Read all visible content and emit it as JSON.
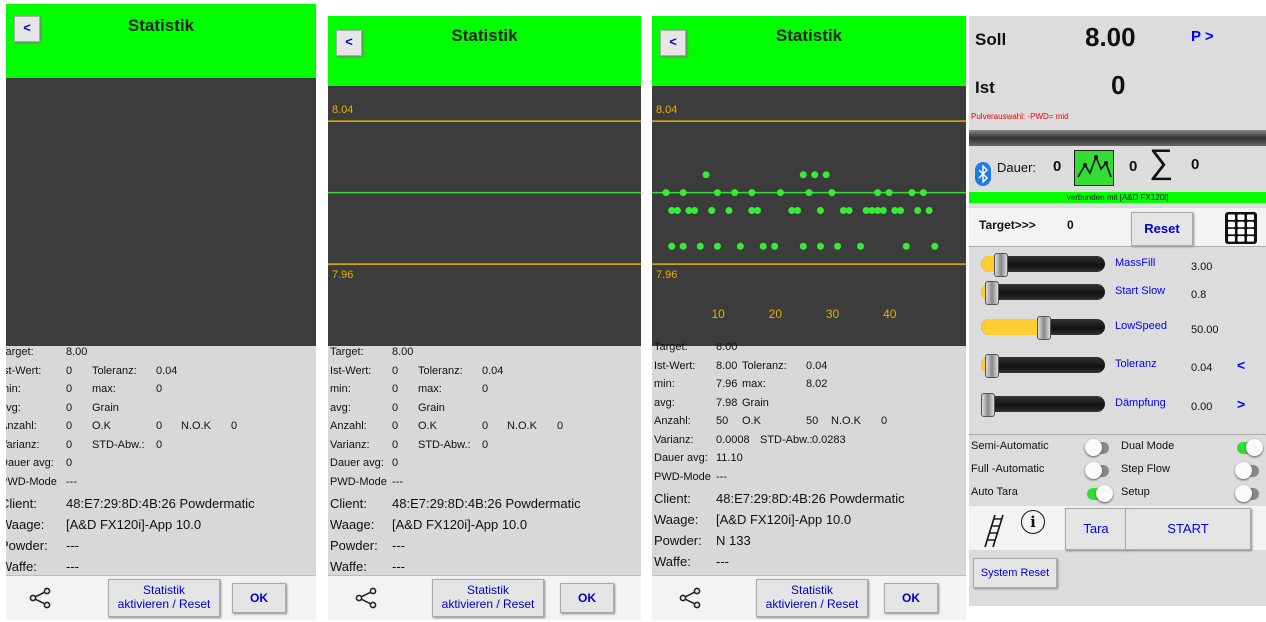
{
  "panels": [
    {
      "header": {
        "back_label": "<",
        "title": "Statistik"
      },
      "plot": {
        "upper_label": "",
        "lower_label": "",
        "x_ticks": []
      },
      "stats": {
        "target_label": "Target:",
        "target_value": "8.00",
        "ist_label": "Ist-Wert:",
        "ist_value": "0",
        "toleranz_label": "Toleranz:",
        "toleranz_value": "0.04",
        "min_label": "min:",
        "min_value": "0",
        "max_label": "max:",
        "max_value": "0",
        "avg_label": "avg:",
        "avg_value": "0",
        "unit": "Grain",
        "anzahl_label": "Anzahl:",
        "anzahl_value": "0",
        "ok_label": "O.K",
        "ok_value": "0",
        "nok_label": "N.O.K",
        "nok_value": "0",
        "varianz_label": "Varianz:",
        "varianz_value": "0",
        "std_label": "STD-Abw.:",
        "std_value": "0",
        "dauer_label": "Dauer avg:",
        "dauer_value": "0",
        "pwd_label": "PWD-Mode",
        "pwd_value": "---",
        "client_label": "Client:",
        "client_value": "48:E7:29:8D:4B:26 Powdermatic",
        "waage_label": "Waage:",
        "waage_value": "[A&D FX120i]-App 10.0",
        "powder_label": "Powder:",
        "powder_value": "---",
        "waffe_label": "Waffe:",
        "waffe_value": "---"
      },
      "buttons": {
        "stat_line1": "Statistik",
        "stat_line2": "aktivieren / Reset",
        "ok": "OK"
      }
    },
    {
      "header": {
        "back_label": "<",
        "title": "Statistik"
      },
      "plot": {
        "upper_label": "8.04",
        "lower_label": "7.96",
        "x_ticks": []
      },
      "stats": {
        "target_label": "Target:",
        "target_value": "8.00",
        "ist_label": "Ist-Wert:",
        "ist_value": "0",
        "toleranz_label": "Toleranz:",
        "toleranz_value": "0.04",
        "min_label": "min:",
        "min_value": "0",
        "max_label": "max:",
        "max_value": "0",
        "avg_label": "avg:",
        "avg_value": "0",
        "unit": "Grain",
        "anzahl_label": "Anzahl:",
        "anzahl_value": "0",
        "ok_label": "O.K",
        "ok_value": "0",
        "nok_label": "N.O.K",
        "nok_value": "0",
        "varianz_label": "Varianz:",
        "varianz_value": "0",
        "std_label": "STD-Abw.:",
        "std_value": "0",
        "dauer_label": "Dauer avg:",
        "dauer_value": "0",
        "pwd_label": "PWD-Mode",
        "pwd_value": "---",
        "client_label": "Client:",
        "client_value": "48:E7:29:8D:4B:26 Powdermatic",
        "waage_label": "Waage:",
        "waage_value": "[A&D FX120i]-App 10.0",
        "powder_label": "Powder:",
        "powder_value": "---",
        "waffe_label": "Waffe:",
        "waffe_value": "---"
      },
      "buttons": {
        "stat_line1": "Statistik",
        "stat_line2": "aktivieren / Reset",
        "ok": "OK"
      }
    },
    {
      "header": {
        "back_label": "<",
        "title": "Statistik"
      },
      "plot": {
        "upper_label": "8.04",
        "lower_label": "7.96",
        "x_ticks": [
          "10",
          "20",
          "30",
          "40"
        ]
      },
      "stats": {
        "target_label": "Target:",
        "target_value": "8.00",
        "ist_label": "Ist-Wert:",
        "ist_value": "8.00",
        "toleranz_label": "Toleranz:",
        "toleranz_value": "0.04",
        "min_label": "min:",
        "min_value": "7.96",
        "max_label": "max:",
        "max_value": "8.02",
        "avg_label": "avg:",
        "avg_value": "7.98",
        "unit": "Grain",
        "anzahl_label": "Anzahl:",
        "anzahl_value": "50",
        "ok_label": "O.K",
        "ok_value": "50",
        "nok_label": "N.O.K",
        "nok_value": "0",
        "varianz_label": "Varianz:",
        "varianz_value": "0.0008",
        "std_label": "STD-Abw.:",
        "std_value": "0.0283",
        "dauer_label": "Dauer avg:",
        "dauer_value": "11.10",
        "pwd_label": "PWD-Mode",
        "pwd_value": "---",
        "client_label": "Client:",
        "client_value": "48:E7:29:8D:4B:26 Powdermatic",
        "waage_label": "Waage:",
        "waage_value": "[A&D FX120i]-App 10.0",
        "powder_label": "Powder:",
        "powder_value": "N 133",
        "waffe_label": "Waffe:",
        "waffe_value": "---"
      },
      "buttons": {
        "stat_line1": "Statistik",
        "stat_line2": "aktivieren / Reset",
        "ok": "OK"
      }
    }
  ],
  "chart_data": {
    "type": "scatter",
    "xlabel": "",
    "ylabel": "",
    "x_ticks": [
      10,
      20,
      30,
      40
    ],
    "xlim": [
      1,
      51
    ],
    "ylim": [
      7.95,
      8.06
    ],
    "reference_lines": {
      "upper": 8.04,
      "target": 8.0,
      "lower": 7.96
    },
    "points": [
      [
        1,
        8.0
      ],
      [
        2,
        7.99
      ],
      [
        2,
        7.97
      ],
      [
        3,
        7.99
      ],
      [
        4,
        8.0
      ],
      [
        4,
        7.97
      ],
      [
        5,
        7.99
      ],
      [
        6,
        7.99
      ],
      [
        7,
        7.97
      ],
      [
        8,
        8.01
      ],
      [
        9,
        7.99
      ],
      [
        10,
        8.0
      ],
      [
        10,
        7.97
      ],
      [
        12,
        7.99
      ],
      [
        13,
        8.0
      ],
      [
        14,
        7.97
      ],
      [
        16,
        7.99
      ],
      [
        16,
        8.0
      ],
      [
        17,
        7.99
      ],
      [
        18,
        7.97
      ],
      [
        20,
        7.97
      ],
      [
        21,
        8.0
      ],
      [
        23,
        7.99
      ],
      [
        24,
        7.99
      ],
      [
        25,
        8.01
      ],
      [
        25,
        7.97
      ],
      [
        26,
        8.0
      ],
      [
        27,
        8.01
      ],
      [
        28,
        7.99
      ],
      [
        28,
        7.97
      ],
      [
        29,
        8.01
      ],
      [
        30,
        8.0
      ],
      [
        31,
        7.97
      ],
      [
        32,
        7.99
      ],
      [
        33,
        7.99
      ],
      [
        35,
        7.97
      ],
      [
        36,
        7.99
      ],
      [
        37,
        7.99
      ],
      [
        38,
        8.0
      ],
      [
        38,
        7.99
      ],
      [
        39,
        7.99
      ],
      [
        40,
        8.0
      ],
      [
        41,
        7.99
      ],
      [
        42,
        7.99
      ],
      [
        43,
        7.97
      ],
      [
        44,
        8.0
      ],
      [
        45,
        7.99
      ],
      [
        46,
        8.0
      ],
      [
        47,
        7.99
      ],
      [
        48,
        7.97
      ]
    ]
  },
  "main_screen": {
    "soll_label": "Soll",
    "soll_value": "8.00",
    "p_button": "P >",
    "ist_label": "Ist",
    "ist_value": "0",
    "powder_select": "Pulverauswahl: -PWD= mid",
    "dauer_label": "Dauer:",
    "dauer_value": "0",
    "count_value": "0",
    "sum_symbol": "∑",
    "sum_value": "0",
    "status": "verbunden mit [A&D FX120i]",
    "target_label": "Target>>>",
    "target_value": "0",
    "reset_button": "Reset",
    "sliders": [
      {
        "label": "MassFill",
        "value": "3.00",
        "level": 0.15
      },
      {
        "label": "Start Slow",
        "value": "0.8",
        "level": 0.08
      },
      {
        "label": "LowSpeed",
        "value": "50.00",
        "level": 0.5
      },
      {
        "label": "Toleranz",
        "value": "0.04",
        "level": 0.08,
        "arrow": "<"
      },
      {
        "label": "Dämpfung",
        "value": "0.00",
        "level": 0.0,
        "arrow": ">"
      }
    ],
    "switches": [
      {
        "label": "Semi-Automatic",
        "on": false
      },
      {
        "label": "Dual Mode",
        "on": true
      },
      {
        "label": "Full -Automatic",
        "on": false
      },
      {
        "label": "Step Flow",
        "on": false
      },
      {
        "label": "Auto Tara",
        "on": true
      },
      {
        "label": "Setup",
        "on": false
      }
    ],
    "tara_button": "Tara",
    "start_button": "START",
    "system_reset_button": "System Reset",
    "colors": {
      "accent_green": "#00ff00",
      "link_blue": "#0000ff",
      "slider_yellow": "#ffcc33",
      "error_red": "#ff0000"
    }
  }
}
